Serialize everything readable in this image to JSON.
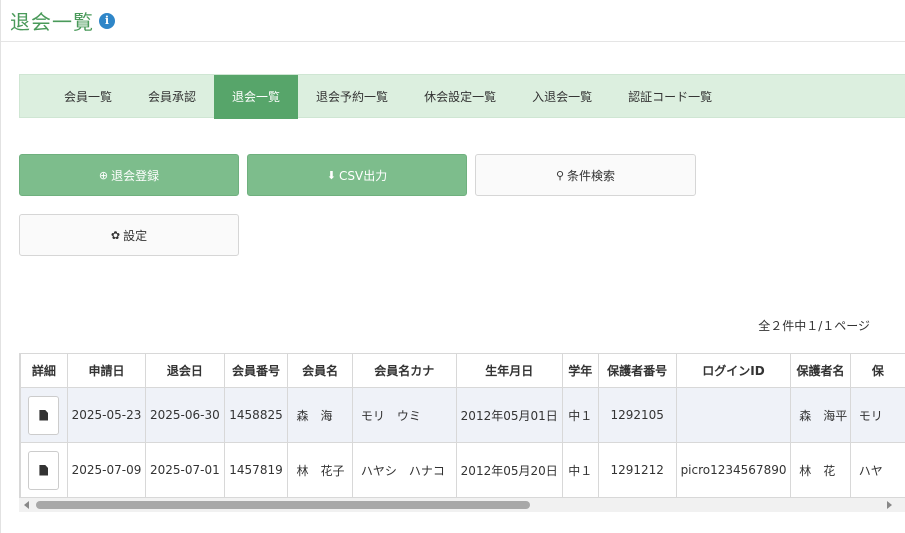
{
  "header": {
    "title": "退会一覧",
    "info_icon": "i"
  },
  "tabs": [
    {
      "label": "会員一覧",
      "active": false
    },
    {
      "label": "会員承認",
      "active": false
    },
    {
      "label": "退会一覧",
      "active": true
    },
    {
      "label": "退会予約一覧",
      "active": false
    },
    {
      "label": "休会設定一覧",
      "active": false
    },
    {
      "label": "入退会一覧",
      "active": false
    },
    {
      "label": "認証コード一覧",
      "active": false
    }
  ],
  "buttons": {
    "register": {
      "icon": "⊕",
      "label": "退会登録"
    },
    "csv": {
      "icon": "⬇",
      "label": "CSV出力"
    },
    "search": {
      "icon": "⚲",
      "label": "条件検索"
    },
    "settings": {
      "icon": "✿",
      "label": "設定"
    }
  },
  "pager": {
    "text": "全２件中１/１ページ"
  },
  "table": {
    "headers": [
      "詳細",
      "申請日",
      "退会日",
      "会員番号",
      "会員名",
      "会員名カナ",
      "生年月日",
      "学年",
      "保護者番号",
      "ログインID",
      "保護者名",
      "保"
    ],
    "rows": [
      [
        "",
        "2025-05-23",
        "2025-06-30",
        "1458825",
        "森　海",
        "モリ　ウミ",
        "2012年05月01日",
        "中１",
        "1292105",
        "",
        "森　海平",
        "モリ"
      ],
      [
        "",
        "2025-07-09",
        "2025-07-01",
        "1457819",
        "林　花子",
        "ハヤシ　ハナコ",
        "2012年05月20日",
        "中１",
        "1291212",
        "picro1234567890",
        "林　花",
        "ハヤ"
      ]
    ]
  },
  "colors": {
    "accent": "#57a56a",
    "tab_bg": "#dcefdf",
    "button_green": "#7dbd8c",
    "title": "#4a9a5a",
    "info": "#2f86c8"
  }
}
